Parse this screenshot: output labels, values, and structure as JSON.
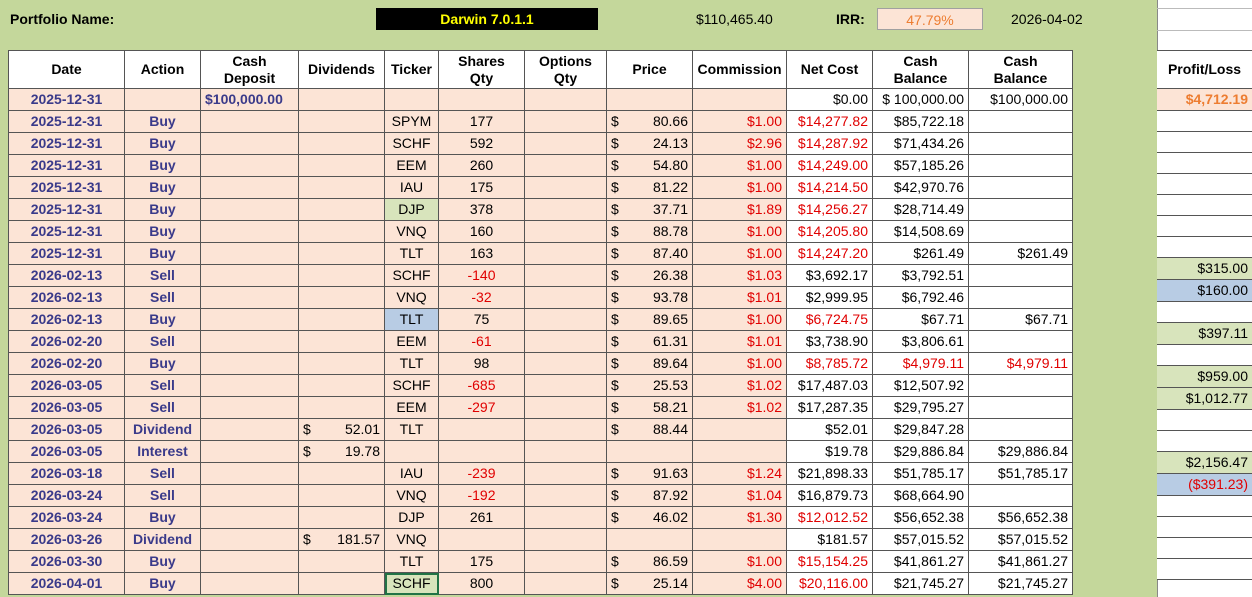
{
  "header": {
    "portfolio_label": "Portfolio Name:",
    "portfolio_name": "Darwin 7.0.1.1",
    "total_value": "$110,465.40",
    "irr_label": "IRR:",
    "irr_value": "47.79%",
    "date": "2026-04-02"
  },
  "columns": {
    "date": "Date",
    "action": "Action",
    "cash_deposit_1": "Cash",
    "cash_deposit_2": "Deposit",
    "dividends": "Dividends",
    "ticker": "Ticker",
    "shares_1": "Shares",
    "shares_2": "Qty",
    "options_1": "Options",
    "options_2": "Qty",
    "price": "Price",
    "commission": "Commission",
    "net_cost": "Net Cost",
    "cash_balance_1": "Cash",
    "cash_balance_2": "Balance",
    "cash_balance2_1": "Cash",
    "cash_balance2_2": "Balance",
    "profit_loss": "Profit/Loss"
  },
  "rows": [
    {
      "date": "2025-12-31",
      "action": "",
      "deposit": "$100,000.00",
      "div": "",
      "ticker": "",
      "shares": "",
      "price": "",
      "comm": "",
      "net": "$0.00",
      "bal": "$ 100,000.00",
      "bal2": "$100,000.00",
      "pl": "$4,712.19"
    },
    {
      "date": "2025-12-31",
      "action": "Buy",
      "deposit": "",
      "div": "",
      "ticker": "SPYM",
      "shares": "177",
      "price": "80.66",
      "comm": "$1.00",
      "net": "$14,277.82",
      "bal": "$85,722.18",
      "bal2": "",
      "pl": ""
    },
    {
      "date": "2025-12-31",
      "action": "Buy",
      "deposit": "",
      "div": "",
      "ticker": "SCHF",
      "shares": "592",
      "price": "24.13",
      "comm": "$2.96",
      "net": "$14,287.92",
      "bal": "$71,434.26",
      "bal2": "",
      "pl": ""
    },
    {
      "date": "2025-12-31",
      "action": "Buy",
      "deposit": "",
      "div": "",
      "ticker": "EEM",
      "shares": "260",
      "price": "54.80",
      "comm": "$1.00",
      "net": "$14,249.00",
      "bal": "$57,185.26",
      "bal2": "",
      "pl": ""
    },
    {
      "date": "2025-12-31",
      "action": "Buy",
      "deposit": "",
      "div": "",
      "ticker": "IAU",
      "shares": "175",
      "price": "81.22",
      "comm": "$1.00",
      "net": "$14,214.50",
      "bal": "$42,970.76",
      "bal2": "",
      "pl": ""
    },
    {
      "date": "2025-12-31",
      "action": "Buy",
      "deposit": "",
      "div": "",
      "ticker": "DJP",
      "shares": "378",
      "price": "37.71",
      "comm": "$1.89",
      "net": "$14,256.27",
      "bal": "$28,714.49",
      "bal2": "",
      "pl": ""
    },
    {
      "date": "2025-12-31",
      "action": "Buy",
      "deposit": "",
      "div": "",
      "ticker": "VNQ",
      "shares": "160",
      "price": "88.78",
      "comm": "$1.00",
      "net": "$14,205.80",
      "bal": "$14,508.69",
      "bal2": "",
      "pl": ""
    },
    {
      "date": "2025-12-31",
      "action": "Buy",
      "deposit": "",
      "div": "",
      "ticker": "TLT",
      "shares": "163",
      "price": "87.40",
      "comm": "$1.00",
      "net": "$14,247.20",
      "bal": "$261.49",
      "bal2": "$261.49",
      "pl": ""
    },
    {
      "date": "2026-02-13",
      "action": "Sell",
      "deposit": "",
      "div": "",
      "ticker": "SCHF",
      "shares": "-140",
      "price": "26.38",
      "comm": "$1.03",
      "net": "$3,692.17",
      "bal": "$3,792.51",
      "bal2": "",
      "pl": "$315.00"
    },
    {
      "date": "2026-02-13",
      "action": "Sell",
      "deposit": "",
      "div": "",
      "ticker": "VNQ",
      "shares": "-32",
      "price": "93.78",
      "comm": "$1.01",
      "net": "$2,999.95",
      "bal": "$6,792.46",
      "bal2": "",
      "pl": "$160.00"
    },
    {
      "date": "2026-02-13",
      "action": "Buy",
      "deposit": "",
      "div": "",
      "ticker": "TLT",
      "shares": "75",
      "price": "89.65",
      "comm": "$1.00",
      "net": "$6,724.75",
      "bal": "$67.71",
      "bal2": "$67.71",
      "pl": ""
    },
    {
      "date": "2026-02-20",
      "action": "Sell",
      "deposit": "",
      "div": "",
      "ticker": "EEM",
      "shares": "-61",
      "price": "61.31",
      "comm": "$1.01",
      "net": "$3,738.90",
      "bal": "$3,806.61",
      "bal2": "",
      "pl": "$397.11"
    },
    {
      "date": "2026-02-20",
      "action": "Buy",
      "deposit": "",
      "div": "",
      "ticker": "TLT",
      "shares": "98",
      "price": "89.64",
      "comm": "$1.00",
      "net": "$8,785.72",
      "bal": "$4,979.11",
      "bal2": "$4,979.11",
      "pl": ""
    },
    {
      "date": "2026-03-05",
      "action": "Sell",
      "deposit": "",
      "div": "",
      "ticker": "SCHF",
      "shares": "-685",
      "price": "25.53",
      "comm": "$1.02",
      "net": "$17,487.03",
      "bal": "$12,507.92",
      "bal2": "",
      "pl": "$959.00"
    },
    {
      "date": "2026-03-05",
      "action": "Sell",
      "deposit": "",
      "div": "",
      "ticker": "EEM",
      "shares": "-297",
      "price": "58.21",
      "comm": "$1.02",
      "net": "$17,287.35",
      "bal": "$29,795.27",
      "bal2": "",
      "pl": "$1,012.77"
    },
    {
      "date": "2026-03-05",
      "action": "Dividend",
      "deposit": "",
      "div": "52.01",
      "ticker": "TLT",
      "shares": "",
      "price": "88.44",
      "comm": "",
      "net": "$52.01",
      "bal": "$29,847.28",
      "bal2": "",
      "pl": ""
    },
    {
      "date": "2026-03-05",
      "action": "Interest",
      "deposit": "",
      "div": "19.78",
      "ticker": "",
      "shares": "",
      "price": "",
      "comm": "",
      "net": "$19.78",
      "bal": "$29,886.84",
      "bal2": "$29,886.84",
      "pl": ""
    },
    {
      "date": "2026-03-18",
      "action": "Sell",
      "deposit": "",
      "div": "",
      "ticker": "IAU",
      "shares": "-239",
      "price": "91.63",
      "comm": "$1.24",
      "net": "$21,898.33",
      "bal": "$51,785.17",
      "bal2": "$51,785.17",
      "pl": "$2,156.47"
    },
    {
      "date": "2026-03-24",
      "action": "Sell",
      "deposit": "",
      "div": "",
      "ticker": "VNQ",
      "shares": "-192",
      "price": "87.92",
      "comm": "$1.04",
      "net": "$16,879.73",
      "bal": "$68,664.90",
      "bal2": "",
      "pl": "($391.23)"
    },
    {
      "date": "2026-03-24",
      "action": "Buy",
      "deposit": "",
      "div": "",
      "ticker": "DJP",
      "shares": "261",
      "price": "46.02",
      "comm": "$1.30",
      "net": "$12,012.52",
      "bal": "$56,652.38",
      "bal2": "$56,652.38",
      "pl": ""
    },
    {
      "date": "2026-03-26",
      "action": "Dividend",
      "deposit": "",
      "div": "181.57",
      "ticker": "VNQ",
      "shares": "",
      "price": "",
      "comm": "",
      "net": "$181.57",
      "bal": "$57,015.52",
      "bal2": "$57,015.52",
      "pl": ""
    },
    {
      "date": "2026-03-30",
      "action": "Buy",
      "deposit": "",
      "div": "",
      "ticker": "TLT",
      "shares": "175",
      "price": "86.59",
      "comm": "$1.00",
      "net": "$15,154.25",
      "bal": "$41,861.27",
      "bal2": "$41,861.27",
      "pl": ""
    },
    {
      "date": "2026-04-01",
      "action": "Buy",
      "deposit": "",
      "div": "",
      "ticker": "SCHF",
      "shares": "800",
      "price": "25.14",
      "comm": "$4.00",
      "net": "$20,116.00",
      "bal": "$21,745.27",
      "bal2": "$21,745.27",
      "pl": ""
    }
  ],
  "currency_symbol": "$"
}
